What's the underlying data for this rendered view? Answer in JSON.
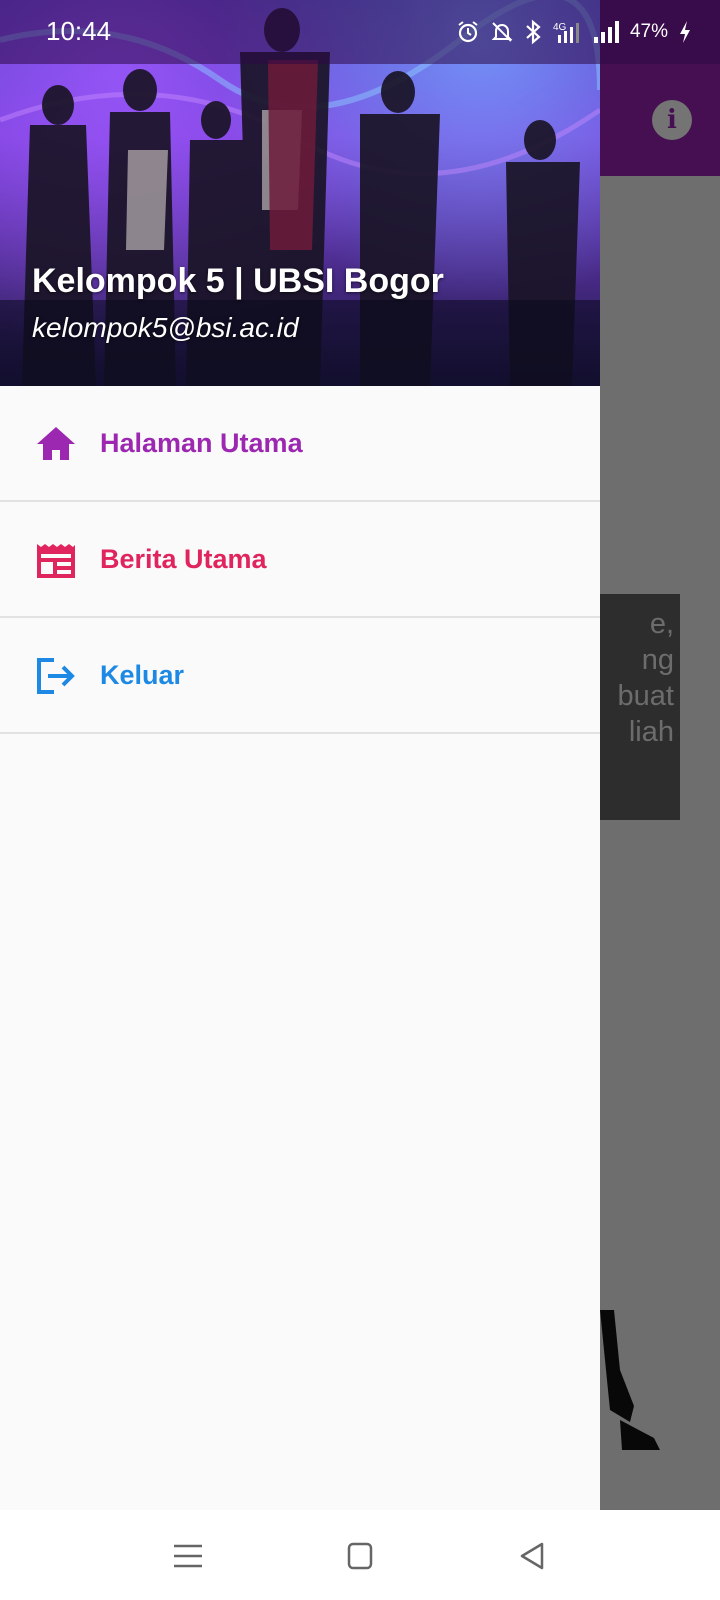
{
  "status_bar": {
    "time": "10:44",
    "battery": "47%",
    "network": "4G",
    "icons": [
      "alarm-icon",
      "notifications-off-icon",
      "bluetooth-icon",
      "mobile-data-icon",
      "signal-icon",
      "battery-charging-icon"
    ]
  },
  "app": {
    "accent_color": "#8a1fa2",
    "info_icon": "info-icon",
    "card_text": "e,\nng\nbuat\nliah"
  },
  "drawer": {
    "header": {
      "name": "Kelompok 5 | UBSI Bogor",
      "email": "kelompok5@bsi.ac.id"
    },
    "items": [
      {
        "label": "Halaman Utama",
        "icon": "home-icon",
        "color": "#9c27b0"
      },
      {
        "label": "Berita Utama",
        "icon": "news-icon",
        "color": "#e0245e"
      },
      {
        "label": "Keluar",
        "icon": "logout-icon",
        "color": "#1e88e5"
      }
    ]
  },
  "nav_bar": {
    "buttons": [
      "menu-icon",
      "home-square-icon",
      "back-icon"
    ]
  }
}
